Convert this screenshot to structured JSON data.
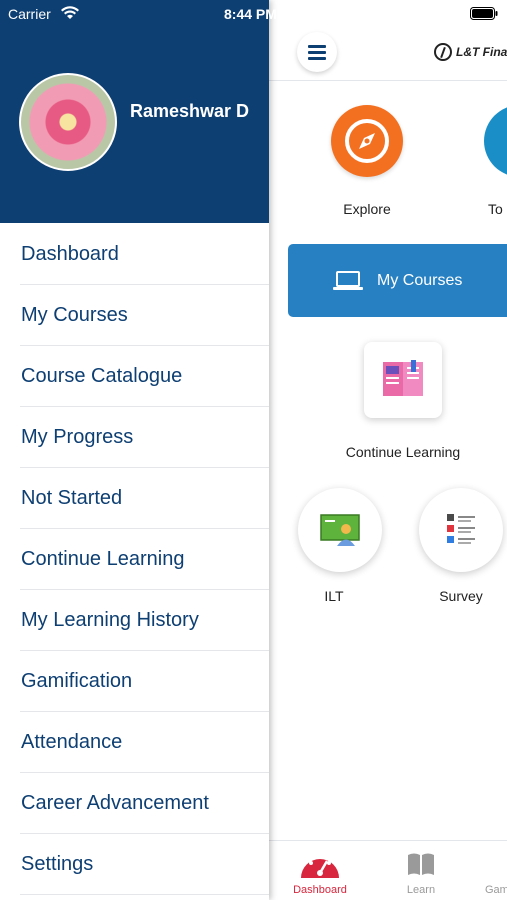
{
  "status_bar": {
    "carrier": "Carrier",
    "time": "8:44 PM",
    "wifi_icon": "wifi-icon",
    "battery_icon": "battery-icon"
  },
  "drawer": {
    "user_name": "Rameshwar D",
    "avatar": "user-avatar-flower",
    "menu_items": [
      {
        "label": "Dashboard"
      },
      {
        "label": "My Courses"
      },
      {
        "label": "Course Catalogue"
      },
      {
        "label": "My Progress"
      },
      {
        "label": "Not Started"
      },
      {
        "label": "Continue Learning"
      },
      {
        "label": "My Learning History"
      },
      {
        "label": "Gamification"
      },
      {
        "label": "Attendance"
      },
      {
        "label": "Career Advancement"
      },
      {
        "label": "Settings"
      }
    ]
  },
  "main": {
    "header": {
      "menu_icon": "hamburger-icon",
      "logo_text": "L&T Finan"
    },
    "tiles": {
      "explore": "Explore",
      "to": "To"
    },
    "my_courses_label": "My Courses",
    "continue_learning_label": "Continue Learning",
    "ilt_label": "ILT",
    "survey_label": "Survey"
  },
  "bottom_nav": {
    "items": [
      {
        "label": "Dashboard",
        "icon": "dashboard-gauge-icon",
        "active": true
      },
      {
        "label": "Learn",
        "icon": "book-icon",
        "active": false
      },
      {
        "label": "Gam",
        "icon": "",
        "active": false
      }
    ]
  },
  "colors": {
    "primary_navy": "#0e3f73",
    "button_blue": "#2680c2",
    "explore_orange": "#f37021",
    "active_red": "#d7263d"
  }
}
